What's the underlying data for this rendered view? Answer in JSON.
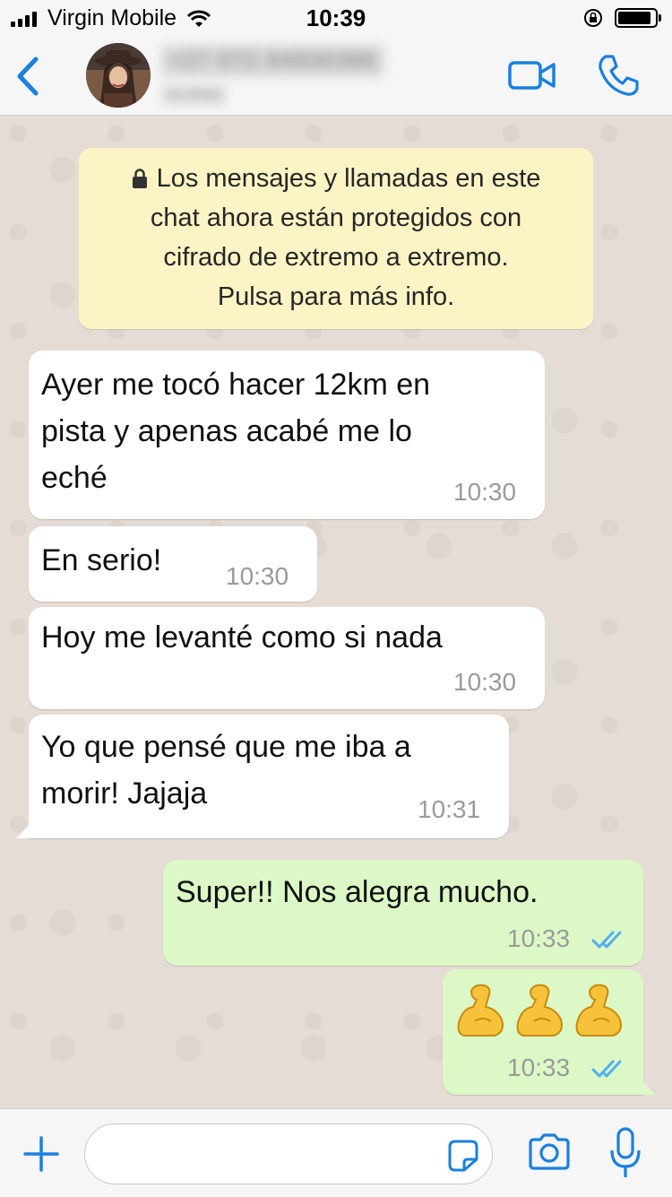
{
  "status_bar": {
    "carrier": "Virgin Mobile",
    "time": "10:39",
    "battery_level": 0.9
  },
  "header": {
    "contact_name": "+27 072 84930386",
    "contact_status": "en línea"
  },
  "chat": {
    "encryption_notice": [
      "Los mensajes y llamadas en este",
      "chat ahora están protegidos con",
      "cifrado de extremo a extremo.",
      "Pulsa para más info."
    ],
    "messages": [
      {
        "direction": "in",
        "lines": [
          "Ayer me tocó hacer 12km en",
          "pista y apenas acabé me lo",
          "eché"
        ],
        "time": "10:30"
      },
      {
        "direction": "in",
        "lines": [
          "En serio!"
        ],
        "time": "10:30"
      },
      {
        "direction": "in",
        "lines": [
          "Hoy me levanté como si nada"
        ],
        "time": "10:30"
      },
      {
        "direction": "in",
        "lines": [
          "Yo que pensé que me iba a",
          "morir! Jajaja"
        ],
        "time": "10:31"
      },
      {
        "direction": "out",
        "lines": [
          "Super!! Nos alegra mucho."
        ],
        "time": "10:33",
        "status": "read"
      },
      {
        "direction": "out",
        "emoji": [
          "flexed-biceps",
          "flexed-biceps",
          "flexed-biceps"
        ],
        "time": "10:33",
        "status": "read"
      }
    ]
  },
  "input_bar": {
    "message_value": ""
  },
  "colors": {
    "accent": "#1a7fe0",
    "chat_background": "#e5ddd5",
    "outgoing_bubble": "#dcf8c6",
    "incoming_bubble": "#ffffff",
    "notice_bubble": "#fdf4c5",
    "read_ticks": "#4fb0f0"
  }
}
